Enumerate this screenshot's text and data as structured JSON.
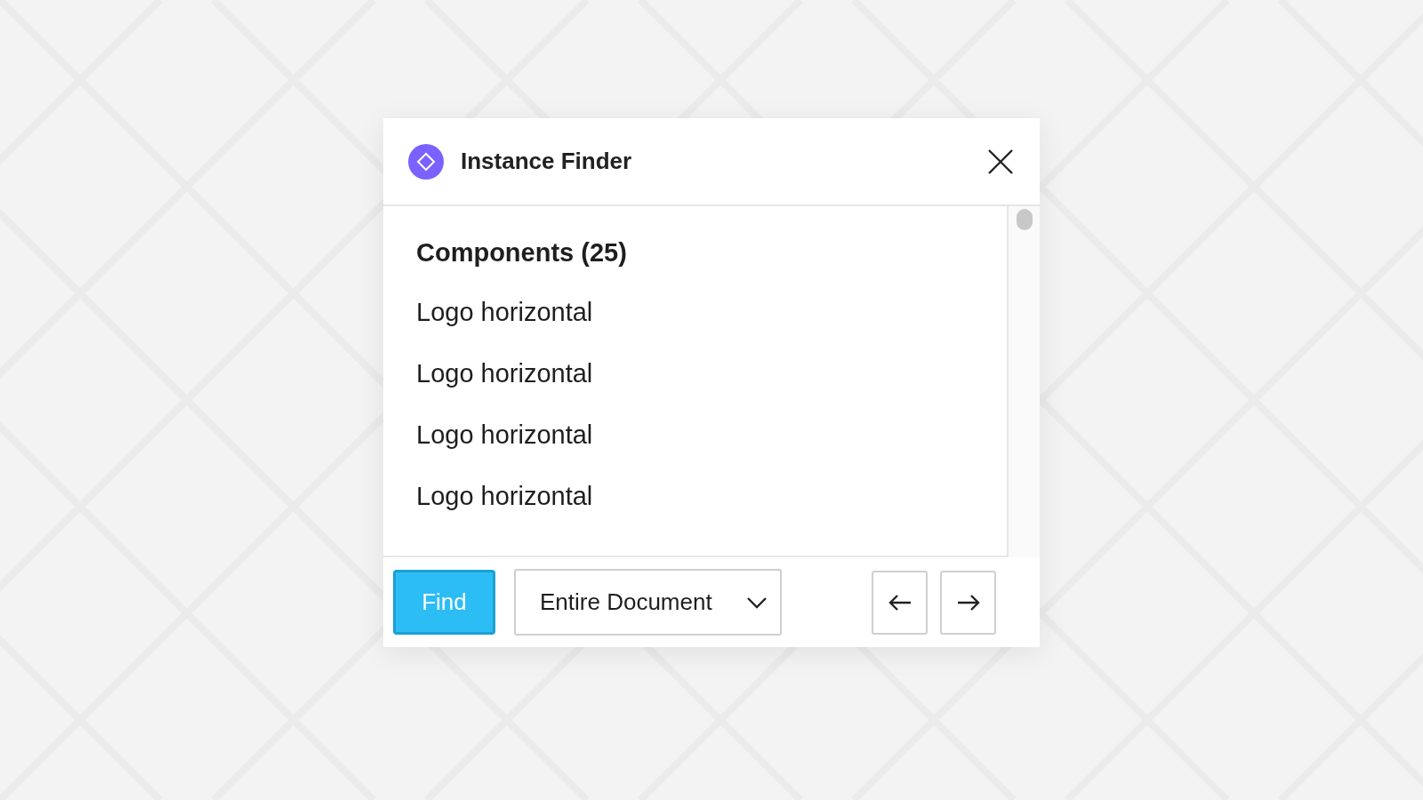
{
  "window": {
    "title": "Instance Finder"
  },
  "list": {
    "heading": "Components (25)",
    "items": [
      {
        "label": "Logo horizontal"
      },
      {
        "label": "Logo horizontal"
      },
      {
        "label": "Logo horizontal"
      },
      {
        "label": "Logo horizontal"
      }
    ]
  },
  "footer": {
    "find_button": "Find",
    "scope": {
      "value": "Entire Document"
    }
  }
}
